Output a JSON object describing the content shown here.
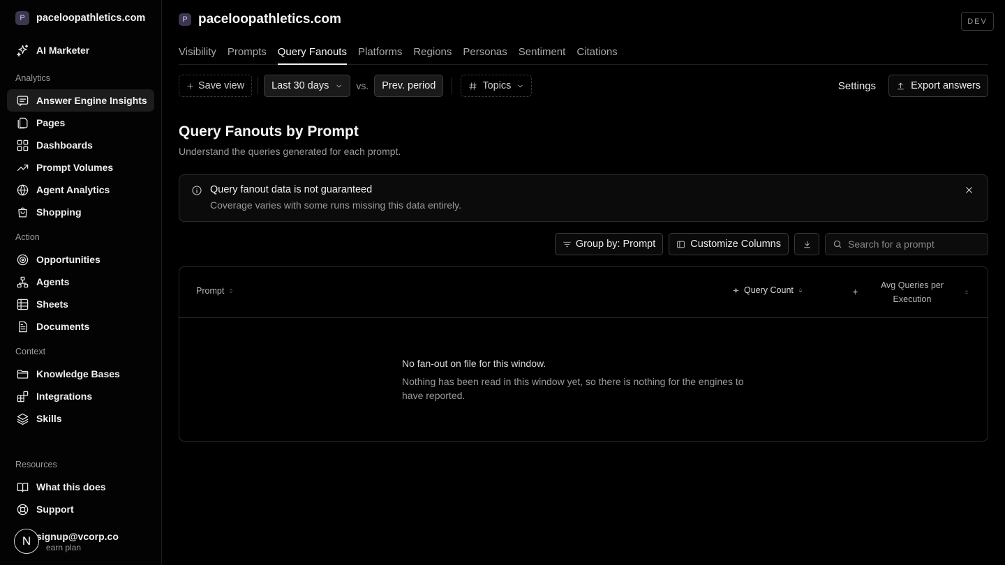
{
  "workspace": {
    "badge": "P",
    "name": "paceloopathletics.com"
  },
  "sidebar": {
    "top_item": {
      "label": "AI Marketer",
      "icon": "sparkles-icon"
    },
    "sections": [
      {
        "label": "Analytics",
        "items": [
          {
            "label": "Answer Engine Insights",
            "icon": "message-square-icon",
            "active": true
          },
          {
            "label": "Pages",
            "icon": "files-icon"
          },
          {
            "label": "Dashboards",
            "icon": "grid-icon"
          },
          {
            "label": "Prompt Volumes",
            "icon": "trending-up-icon"
          },
          {
            "label": "Agent Analytics",
            "icon": "globe-icon"
          },
          {
            "label": "Shopping",
            "icon": "shopping-bag-icon"
          }
        ]
      },
      {
        "label": "Action",
        "items": [
          {
            "label": "Opportunities",
            "icon": "target-icon"
          },
          {
            "label": "Agents",
            "icon": "network-icon"
          },
          {
            "label": "Sheets",
            "icon": "table-icon"
          },
          {
            "label": "Documents",
            "icon": "document-icon"
          }
        ]
      },
      {
        "label": "Context",
        "items": [
          {
            "label": "Knowledge Bases",
            "icon": "folder-icon"
          },
          {
            "label": "Integrations",
            "icon": "blocks-icon"
          },
          {
            "label": "Skills",
            "icon": "layers-icon"
          }
        ]
      }
    ],
    "resources": {
      "label": "Resources",
      "items": [
        {
          "label": "What this does",
          "icon": "book-icon"
        },
        {
          "label": "Support",
          "icon": "lifebuoy-icon"
        }
      ]
    },
    "user": {
      "avatar": "N",
      "email": "signup@vcorp.co",
      "plan": "earn plan"
    }
  },
  "header": {
    "env_badge": "DEV"
  },
  "tabs": [
    {
      "label": "Visibility"
    },
    {
      "label": "Prompts"
    },
    {
      "label": "Query Fanouts",
      "active": true
    },
    {
      "label": "Platforms"
    },
    {
      "label": "Regions"
    },
    {
      "label": "Personas"
    },
    {
      "label": "Sentiment"
    },
    {
      "label": "Citations"
    }
  ],
  "toolbar": {
    "save_view": "Save view",
    "date_range": "Last 30 days",
    "vs": "vs.",
    "compare": "Prev. period",
    "topics": "Topics",
    "settings": "Settings",
    "export": "Export answers"
  },
  "page": {
    "title": "Query Fanouts by Prompt",
    "subtitle": "Understand the queries generated for each prompt."
  },
  "alert": {
    "title": "Query fanout data is not guaranteed",
    "body": "Coverage varies with some runs missing this data entirely."
  },
  "controls": {
    "group_by": "Group by: Prompt",
    "customize": "Customize Columns",
    "search_placeholder": "Search for a prompt"
  },
  "table": {
    "columns": {
      "prompt": "Prompt",
      "query_count": "Query Count",
      "avg_line1": "Avg Queries per",
      "avg_line2": "Execution"
    },
    "empty": {
      "title": "No fan-out on file for this window.",
      "body": "Nothing has been read in this window yet, so there is nothing for the engines to have reported."
    }
  }
}
